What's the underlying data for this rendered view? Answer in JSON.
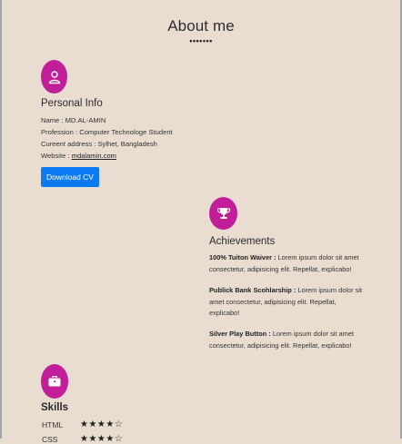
{
  "header": {
    "title": "About me",
    "dots": "•••••••"
  },
  "personal": {
    "title": "Personal Info",
    "lines": {
      "name": "Name : MD.AL-AMIN",
      "profession": "Profession : Computer Technologe Student",
      "address": "Cureent address : Sylhet, Bangladesh",
      "website_prefix": "Website : ",
      "website_link": "mdalamin.com"
    },
    "download_label": "Download CV",
    "icon": "user-icon"
  },
  "achievements": {
    "title": "Achievements",
    "icon": "trophy-icon",
    "items": [
      {
        "heading": "100% Tuiton Waiver :",
        "text": " Lorem ipsum dolor sit amet consectetur, adipisicing elit. Repellat, explicabo!"
      },
      {
        "heading": "Publick Bank Scohlarship :",
        "text": " Lorem ipsum dolor sit amet consectetur, adipisicing elit. Repellat, explicabo!"
      },
      {
        "heading": "Silver Play Button :",
        "text": " Lorem ipsum dolor sit amet consectetur, adipisicing elit. Repellat, explicabo!"
      }
    ]
  },
  "skills": {
    "title": "Skills",
    "icon": "briefcase-icon",
    "items": [
      {
        "name": "HTML",
        "stars": "★★★★☆",
        "rating": 4
      },
      {
        "name": "CSS",
        "stars": "★★★★☆",
        "rating": 4
      }
    ]
  },
  "colors": {
    "accent": "#c21e9a",
    "button": "#0d7af5",
    "background": "#e9ddd1"
  }
}
